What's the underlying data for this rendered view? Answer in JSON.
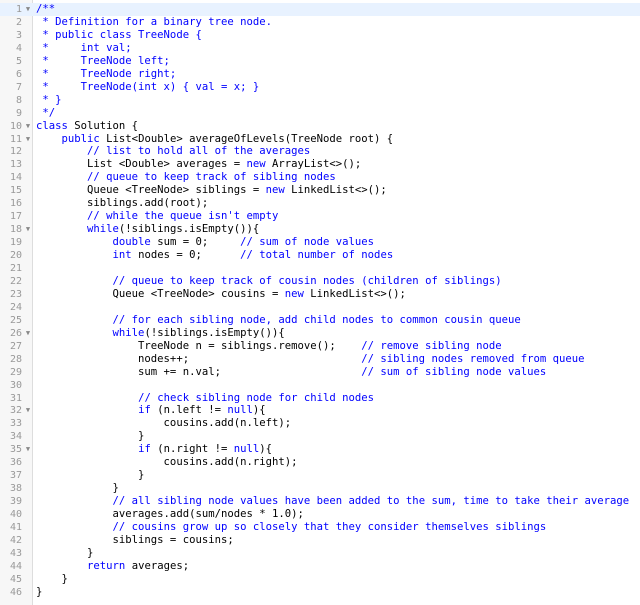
{
  "editor": {
    "language": "java",
    "fold_icon": "caret-down-icon",
    "colors": {
      "keyword": "#0000ff",
      "comment": "#0000ff",
      "text": "#000000",
      "line_number": "#999999",
      "gutter_bg": "#f7f7f7",
      "active_line_bg": "#e8f2ff"
    },
    "active_line": 1,
    "lines": [
      {
        "n": "1",
        "fold": true,
        "tokens": [
          [
            "c",
            "/**"
          ]
        ]
      },
      {
        "n": "2",
        "fold": false,
        "tokens": [
          [
            "c",
            " * Definition for a binary tree node."
          ]
        ]
      },
      {
        "n": "3",
        "fold": false,
        "tokens": [
          [
            "c",
            " * public class TreeNode {"
          ]
        ]
      },
      {
        "n": "4",
        "fold": false,
        "tokens": [
          [
            "c",
            " *     int val;"
          ]
        ]
      },
      {
        "n": "5",
        "fold": false,
        "tokens": [
          [
            "c",
            " *     TreeNode left;"
          ]
        ]
      },
      {
        "n": "6",
        "fold": false,
        "tokens": [
          [
            "c",
            " *     TreeNode right;"
          ]
        ]
      },
      {
        "n": "7",
        "fold": false,
        "tokens": [
          [
            "c",
            " *     TreeNode(int x) { val = x; }"
          ]
        ]
      },
      {
        "n": "8",
        "fold": false,
        "tokens": [
          [
            "c",
            " * }"
          ]
        ]
      },
      {
        "n": "9",
        "fold": false,
        "tokens": [
          [
            "c",
            " */"
          ]
        ]
      },
      {
        "n": "10",
        "fold": true,
        "tokens": [
          [
            "k",
            "class"
          ],
          [
            "t",
            " Solution {"
          ]
        ]
      },
      {
        "n": "11",
        "fold": true,
        "tokens": [
          [
            "t",
            "    "
          ],
          [
            "k",
            "public"
          ],
          [
            "t",
            " List<Double> averageOfLevels(TreeNode root) {"
          ]
        ]
      },
      {
        "n": "12",
        "fold": false,
        "tokens": [
          [
            "t",
            "        "
          ],
          [
            "c",
            "// list to hold all of the averages"
          ]
        ]
      },
      {
        "n": "13",
        "fold": false,
        "tokens": [
          [
            "t",
            "        List <Double> averages = "
          ],
          [
            "k",
            "new"
          ],
          [
            "t",
            " ArrayList<>();"
          ]
        ]
      },
      {
        "n": "14",
        "fold": false,
        "tokens": [
          [
            "t",
            "        "
          ],
          [
            "c",
            "// queue to keep track of sibling nodes"
          ]
        ]
      },
      {
        "n": "15",
        "fold": false,
        "tokens": [
          [
            "t",
            "        Queue <TreeNode> siblings = "
          ],
          [
            "k",
            "new"
          ],
          [
            "t",
            " LinkedList<>();"
          ]
        ]
      },
      {
        "n": "16",
        "fold": false,
        "tokens": [
          [
            "t",
            "        siblings.add(root);"
          ]
        ]
      },
      {
        "n": "17",
        "fold": false,
        "tokens": [
          [
            "t",
            "        "
          ],
          [
            "c",
            "// while the queue isn't empty"
          ]
        ]
      },
      {
        "n": "18",
        "fold": true,
        "tokens": [
          [
            "t",
            "        "
          ],
          [
            "k",
            "while"
          ],
          [
            "t",
            "(!siblings.isEmpty()){"
          ]
        ]
      },
      {
        "n": "19",
        "fold": false,
        "tokens": [
          [
            "t",
            "            "
          ],
          [
            "k",
            "double"
          ],
          [
            "t",
            " sum = 0;     "
          ],
          [
            "c",
            "// sum of node values"
          ]
        ]
      },
      {
        "n": "20",
        "fold": false,
        "tokens": [
          [
            "t",
            "            "
          ],
          [
            "k",
            "int"
          ],
          [
            "t",
            " nodes = 0;      "
          ],
          [
            "c",
            "// total number of nodes"
          ]
        ]
      },
      {
        "n": "21",
        "fold": false,
        "tokens": []
      },
      {
        "n": "22",
        "fold": false,
        "tokens": [
          [
            "t",
            "            "
          ],
          [
            "c",
            "// queue to keep track of cousin nodes (children of siblings)"
          ]
        ]
      },
      {
        "n": "23",
        "fold": false,
        "tokens": [
          [
            "t",
            "            Queue <TreeNode> cousins = "
          ],
          [
            "k",
            "new"
          ],
          [
            "t",
            " LinkedList<>();"
          ]
        ]
      },
      {
        "n": "24",
        "fold": false,
        "tokens": []
      },
      {
        "n": "25",
        "fold": false,
        "tokens": [
          [
            "t",
            "            "
          ],
          [
            "c",
            "// for each sibling node, add child nodes to common cousin queue"
          ]
        ]
      },
      {
        "n": "26",
        "fold": true,
        "tokens": [
          [
            "t",
            "            "
          ],
          [
            "k",
            "while"
          ],
          [
            "t",
            "(!siblings.isEmpty()){"
          ]
        ]
      },
      {
        "n": "27",
        "fold": false,
        "tokens": [
          [
            "t",
            "                TreeNode n = siblings.remove();    "
          ],
          [
            "c",
            "// remove sibling node"
          ]
        ]
      },
      {
        "n": "28",
        "fold": false,
        "tokens": [
          [
            "t",
            "                nodes++;                           "
          ],
          [
            "c",
            "// sibling nodes removed from queue"
          ]
        ]
      },
      {
        "n": "29",
        "fold": false,
        "tokens": [
          [
            "t",
            "                sum += n.val;                      "
          ],
          [
            "c",
            "// sum of sibling node values"
          ]
        ]
      },
      {
        "n": "30",
        "fold": false,
        "tokens": []
      },
      {
        "n": "31",
        "fold": false,
        "tokens": [
          [
            "t",
            "                "
          ],
          [
            "c",
            "// check sibling node for child nodes"
          ]
        ]
      },
      {
        "n": "32",
        "fold": true,
        "tokens": [
          [
            "t",
            "                "
          ],
          [
            "k",
            "if"
          ],
          [
            "t",
            " (n.left != "
          ],
          [
            "k",
            "null"
          ],
          [
            "t",
            "){"
          ]
        ]
      },
      {
        "n": "33",
        "fold": false,
        "tokens": [
          [
            "t",
            "                    cousins.add(n.left);"
          ]
        ]
      },
      {
        "n": "34",
        "fold": false,
        "tokens": [
          [
            "t",
            "                }"
          ]
        ]
      },
      {
        "n": "35",
        "fold": true,
        "tokens": [
          [
            "t",
            "                "
          ],
          [
            "k",
            "if"
          ],
          [
            "t",
            " (n.right != "
          ],
          [
            "k",
            "null"
          ],
          [
            "t",
            "){"
          ]
        ]
      },
      {
        "n": "36",
        "fold": false,
        "tokens": [
          [
            "t",
            "                    cousins.add(n.right);"
          ]
        ]
      },
      {
        "n": "37",
        "fold": false,
        "tokens": [
          [
            "t",
            "                }"
          ]
        ]
      },
      {
        "n": "38",
        "fold": false,
        "tokens": [
          [
            "t",
            "            }"
          ]
        ]
      },
      {
        "n": "39",
        "fold": false,
        "tokens": [
          [
            "t",
            "            "
          ],
          [
            "c",
            "// all sibling node values have been added to the sum, time to take their average"
          ]
        ]
      },
      {
        "n": "40",
        "fold": false,
        "tokens": [
          [
            "t",
            "            averages.add(sum/nodes * 1.0);"
          ]
        ]
      },
      {
        "n": "41",
        "fold": false,
        "tokens": [
          [
            "t",
            "            "
          ],
          [
            "c",
            "// cousins grow up so closely that they consider themselves siblings"
          ]
        ]
      },
      {
        "n": "42",
        "fold": false,
        "tokens": [
          [
            "t",
            "            siblings = cousins;"
          ]
        ]
      },
      {
        "n": "43",
        "fold": false,
        "tokens": [
          [
            "t",
            "        }"
          ]
        ]
      },
      {
        "n": "44",
        "fold": false,
        "tokens": [
          [
            "t",
            "        "
          ],
          [
            "k",
            "return"
          ],
          [
            "t",
            " averages;"
          ]
        ]
      },
      {
        "n": "45",
        "fold": false,
        "tokens": [
          [
            "t",
            "    }"
          ]
        ]
      },
      {
        "n": "46",
        "fold": false,
        "tokens": [
          [
            "t",
            "}"
          ]
        ]
      }
    ]
  }
}
